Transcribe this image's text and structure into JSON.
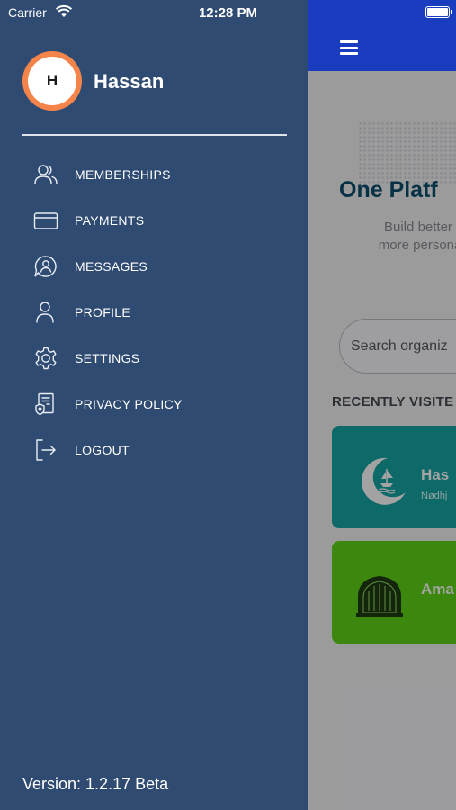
{
  "status_bar": {
    "carrier": "Carrier",
    "time": "12:28 PM"
  },
  "drawer": {
    "avatar_initial": "H",
    "user_name": "Hassan",
    "menu": [
      {
        "label": "MEMBERSHIPS",
        "icon": "users-icon"
      },
      {
        "label": "PAYMENTS",
        "icon": "credit-card-icon"
      },
      {
        "label": "MESSAGES",
        "icon": "message-user-icon"
      },
      {
        "label": "PROFILE",
        "icon": "user-icon"
      },
      {
        "label": "SETTINGS",
        "icon": "gear-icon"
      },
      {
        "label": "PRIVACY POLICY",
        "icon": "policy-document-icon"
      },
      {
        "label": "LOGOUT",
        "icon": "logout-icon"
      }
    ],
    "version": "Version: 1.2.17 Beta"
  },
  "main": {
    "hero_title": "One Platf",
    "hero_subtitle_line1": "Build better cu",
    "hero_subtitle_line2": "more personal e",
    "search_placeholder": "Search organiz",
    "recently_visited_label": "RECENTLY VISITE",
    "cards": [
      {
        "title": "Has",
        "subtitle": "Nødhj"
      },
      {
        "title": "Ama"
      }
    ]
  },
  "colors": {
    "drawer_bg": "#2f4b72",
    "header_blue": "#1a3dbf",
    "avatar_ring": "#f4844a",
    "card_teal": "#16a7a3",
    "card_green": "#5fd315",
    "hero_title": "#0b4f6c"
  }
}
